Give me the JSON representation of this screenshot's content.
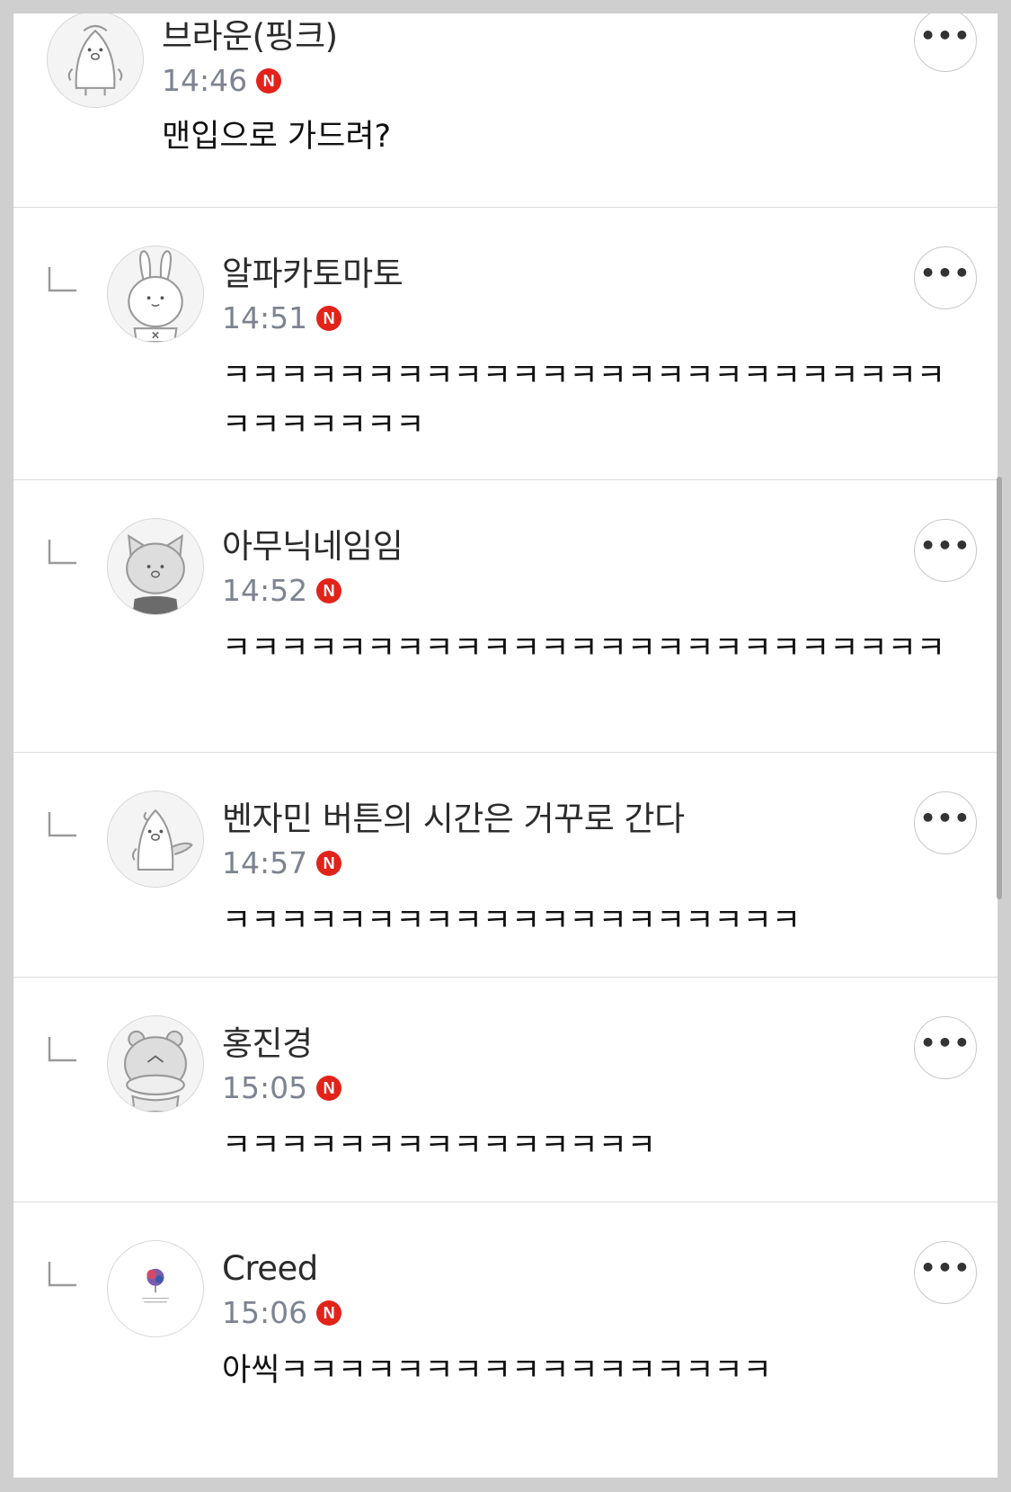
{
  "comments": [
    {
      "author": "브라운(핑크)",
      "time": "14:46",
      "badge": "N",
      "text": "맨입으로 가드려?",
      "avatar_icon": "penguin-avatar-icon",
      "is_reply": false
    },
    {
      "author": "알파카토마토",
      "time": "14:51",
      "badge": "N",
      "text": "ㅋㅋㅋㅋㅋㅋㅋㅋㅋㅋㅋㅋㅋㅋㅋㅋㅋㅋㅋㅋㅋㅋㅋㅋㅋㅋㅋㅋㅋㅋㅋㅋ",
      "avatar_icon": "rabbit-avatar-icon",
      "is_reply": true
    },
    {
      "author": "아무닉네임임",
      "time": "14:52",
      "badge": "N",
      "text": "ㅋㅋㅋㅋㅋㅋㅋㅋㅋㅋㅋㅋㅋㅋㅋㅋㅋㅋㅋㅋㅋㅋㅋㅋㅋ",
      "avatar_icon": "cat-avatar-icon",
      "is_reply": true
    },
    {
      "author": "벤자민 버튼의 시간은 거꾸로 간다",
      "time": "14:57",
      "badge": "N",
      "text": "ㅋㅋㅋㅋㅋㅋㅋㅋㅋㅋㅋㅋㅋㅋㅋㅋㅋㅋㅋㅋ",
      "avatar_icon": "penguin-wave-avatar-icon",
      "is_reply": true
    },
    {
      "author": "홍진경",
      "time": "15:05",
      "badge": "N",
      "text": "ㅋㅋㅋㅋㅋㅋㅋㅋㅋㅋㅋㅋㅋㅋㅋ",
      "avatar_icon": "bear-avatar-icon",
      "is_reply": true
    },
    {
      "author": "Creed",
      "time": "15:06",
      "badge": "N",
      "text": "아씩ㅋㅋㅋㅋㅋㅋㅋㅋㅋㅋㅋㅋㅋㅋㅋㅋㅋ",
      "avatar_icon": "photo-avatar-icon",
      "is_reply": true
    }
  ],
  "more_button_label": "•••",
  "colors": {
    "badge": "#e2231a",
    "time": "#7e8391",
    "divider": "#dcdcdc",
    "background": "#cfcfcf"
  }
}
